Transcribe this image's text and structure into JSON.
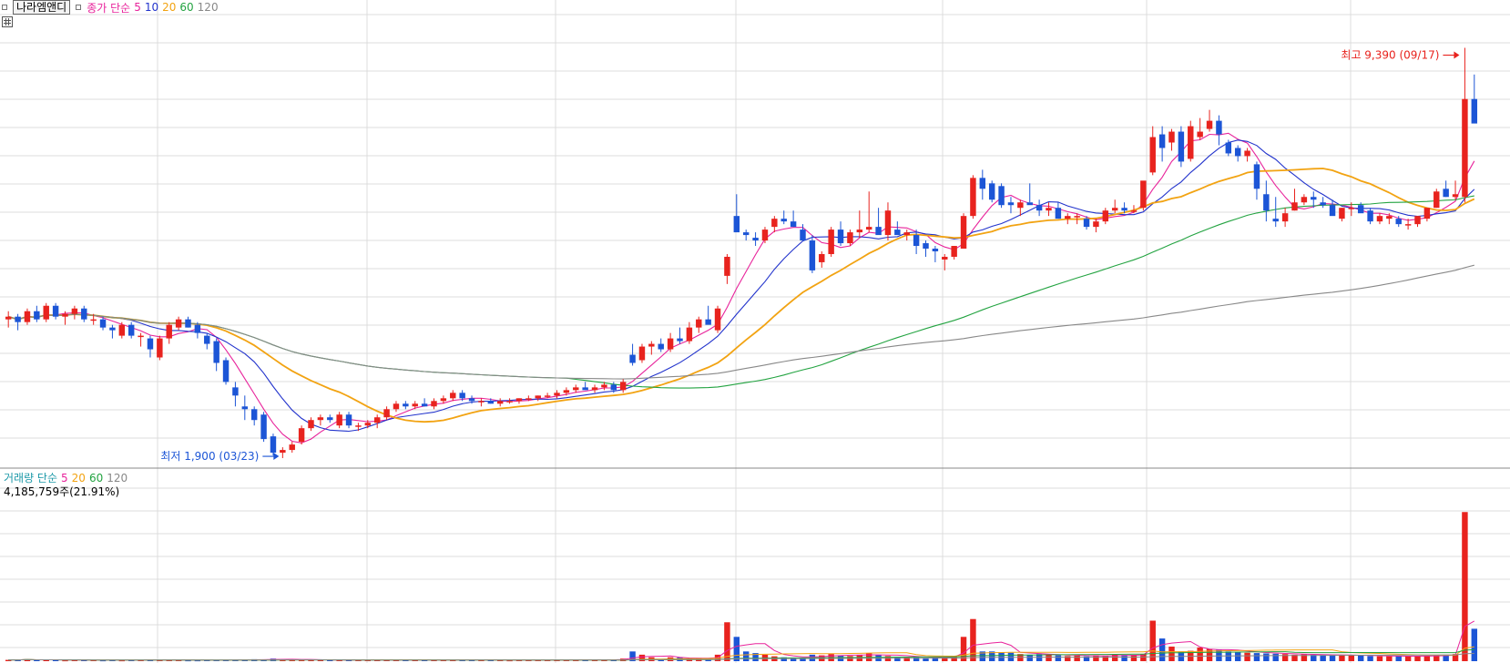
{
  "header": {
    "stock_name": "나라엠앤디",
    "price_legend": {
      "label": "종가 단순",
      "periods": [
        "5",
        "10",
        "20",
        "60",
        "120"
      ]
    },
    "volume_legend": {
      "label": "거래량 단순",
      "periods": [
        "5",
        "20",
        "60",
        "120"
      ]
    },
    "volume_value": "4,185,759주(21.91%)"
  },
  "annotations": {
    "high": "최고 9,390 (09/17)",
    "low": "최저 1,900 (03/23)"
  },
  "colors": {
    "up": "#e8231e",
    "down": "#1c55d6",
    "ma5": "#e8239b",
    "ma10": "#2233cc",
    "ma20": "#f2a312",
    "ma60": "#22a340",
    "ma120": "#888888",
    "grid": "#dcdcdc"
  },
  "chart_data": {
    "type": "candlestick",
    "y_range": [
      1700,
      9600
    ],
    "candles": [
      [
        4400,
        4550,
        4250,
        4450
      ],
      [
        4450,
        4500,
        4200,
        4350
      ],
      [
        4350,
        4600,
        4300,
        4550
      ],
      [
        4550,
        4650,
        4350,
        4400
      ],
      [
        4400,
        4700,
        4350,
        4650
      ],
      [
        4650,
        4700,
        4400,
        4450
      ],
      [
        4450,
        4550,
        4300,
        4500
      ],
      [
        4500,
        4650,
        4400,
        4600
      ],
      [
        4600,
        4650,
        4350,
        4400
      ],
      [
        4400,
        4500,
        4300,
        4400
      ],
      [
        4400,
        4450,
        4200,
        4250
      ],
      [
        4250,
        4300,
        4050,
        4200
      ],
      [
        4100,
        4350,
        4050,
        4300
      ],
      [
        4300,
        4350,
        4050,
        4100
      ],
      [
        4100,
        4150,
        3900,
        4100
      ],
      [
        4050,
        4100,
        3700,
        3850
      ],
      [
        3700,
        4100,
        3650,
        4050
      ],
      [
        4050,
        4350,
        3950,
        4300
      ],
      [
        4250,
        4450,
        4200,
        4400
      ],
      [
        4400,
        4450,
        4250,
        4250
      ],
      [
        4300,
        4350,
        4050,
        4150
      ],
      [
        4100,
        4150,
        3850,
        3950
      ],
      [
        4000,
        4050,
        3450,
        3600
      ],
      [
        3650,
        3700,
        3200,
        3250
      ],
      [
        3150,
        3250,
        2800,
        3000
      ],
      [
        2800,
        3000,
        2550,
        2750
      ],
      [
        2750,
        2800,
        2450,
        2550
      ],
      [
        2650,
        2700,
        2150,
        2200
      ],
      [
        2250,
        2300,
        1900,
        1950
      ],
      [
        1950,
        2050,
        1850,
        2000
      ],
      [
        2000,
        2150,
        1950,
        2100
      ],
      [
        2150,
        2450,
        2100,
        2400
      ],
      [
        2400,
        2600,
        2350,
        2550
      ],
      [
        2550,
        2650,
        2450,
        2600
      ],
      [
        2600,
        2650,
        2500,
        2550
      ],
      [
        2450,
        2700,
        2400,
        2650
      ],
      [
        2650,
        2700,
        2400,
        2450
      ],
      [
        2450,
        2500,
        2350,
        2450
      ],
      [
        2450,
        2550,
        2400,
        2500
      ],
      [
        2500,
        2650,
        2400,
        2600
      ],
      [
        2600,
        2800,
        2550,
        2750
      ],
      [
        2750,
        2900,
        2700,
        2850
      ],
      [
        2850,
        2900,
        2750,
        2800
      ],
      [
        2800,
        2900,
        2750,
        2850
      ],
      [
        2850,
        2950,
        2800,
        2800
      ],
      [
        2800,
        2950,
        2750,
        2900
      ],
      [
        2900,
        3000,
        2850,
        2950
      ],
      [
        2950,
        3100,
        2900,
        3050
      ],
      [
        3050,
        3100,
        2900,
        2950
      ],
      [
        2950,
        3000,
        2850,
        2900
      ],
      [
        2900,
        2950,
        2800,
        2900
      ],
      [
        2900,
        2950,
        2850,
        2850
      ],
      [
        2850,
        2950,
        2800,
        2900
      ],
      [
        2900,
        2950,
        2850,
        2900
      ],
      [
        2900,
        2950,
        2850,
        2950
      ],
      [
        2950,
        3000,
        2900,
        2950
      ],
      [
        2950,
        3000,
        2900,
        3000
      ],
      [
        3000,
        3050,
        2950,
        3000
      ],
      [
        3000,
        3100,
        2950,
        3050
      ],
      [
        3050,
        3150,
        3000,
        3100
      ],
      [
        3100,
        3200,
        3050,
        3150
      ],
      [
        3150,
        3250,
        3100,
        3100
      ],
      [
        3100,
        3200,
        3050,
        3150
      ],
      [
        3150,
        3250,
        3100,
        3200
      ],
      [
        3200,
        3250,
        3050,
        3100
      ],
      [
        3100,
        3300,
        3050,
        3250
      ],
      [
        3750,
        3950,
        3550,
        3600
      ],
      [
        3650,
        3950,
        3600,
        3900
      ],
      [
        3900,
        4000,
        3750,
        3950
      ],
      [
        3950,
        4050,
        3800,
        3850
      ],
      [
        3850,
        4150,
        3800,
        4050
      ],
      [
        4050,
        4250,
        3950,
        4000
      ],
      [
        4000,
        4350,
        3950,
        4250
      ],
      [
        4250,
        4450,
        4150,
        4400
      ],
      [
        4400,
        4650,
        4350,
        4300
      ],
      [
        4200,
        4650,
        4150,
        4600
      ],
      [
        5200,
        5600,
        5050,
        5550
      ],
      [
        6300,
        6700,
        6100,
        6000
      ],
      [
        6000,
        6050,
        5850,
        5950
      ],
      [
        5900,
        6000,
        5750,
        5850
      ],
      [
        5850,
        6100,
        5800,
        6050
      ],
      [
        6100,
        6300,
        6000,
        6250
      ],
      [
        6250,
        6400,
        6150,
        6200
      ],
      [
        6200,
        6400,
        6100,
        6100
      ],
      [
        6050,
        6150,
        5850,
        5850
      ],
      [
        5850,
        5950,
        5250,
        5300
      ],
      [
        5450,
        5650,
        5350,
        5600
      ],
      [
        5600,
        6100,
        5550,
        6050
      ],
      [
        6050,
        6200,
        5750,
        5800
      ],
      [
        5800,
        6050,
        5750,
        6000
      ],
      [
        6000,
        6400,
        5900,
        6050
      ],
      [
        6050,
        6750,
        6000,
        6100
      ],
      [
        6100,
        6450,
        6000,
        5950
      ],
      [
        5950,
        6550,
        5850,
        6400
      ],
      [
        6050,
        6200,
        5950,
        5950
      ],
      [
        5950,
        6050,
        5850,
        6000
      ],
      [
        5950,
        6050,
        5600,
        5750
      ],
      [
        5800,
        5850,
        5550,
        5700
      ],
      [
        5700,
        5750,
        5450,
        5650
      ],
      [
        5500,
        5600,
        5300,
        5550
      ],
      [
        5550,
        5750,
        5500,
        5750
      ],
      [
        5700,
        6350,
        5700,
        6300
      ],
      [
        6300,
        7050,
        6250,
        7000
      ],
      [
        7000,
        7150,
        6600,
        6800
      ],
      [
        6900,
        6950,
        6550,
        6600
      ],
      [
        6850,
        6900,
        6450,
        6500
      ],
      [
        6550,
        6650,
        6350,
        6500
      ],
      [
        6450,
        6600,
        6300,
        6550
      ],
      [
        6550,
        6900,
        6550,
        6500
      ],
      [
        6500,
        6600,
        6300,
        6400
      ],
      [
        6400,
        6550,
        6300,
        6450
      ],
      [
        6450,
        6550,
        6250,
        6250
      ],
      [
        6250,
        6350,
        6150,
        6300
      ],
      [
        6300,
        6350,
        6150,
        6300
      ],
      [
        6250,
        6300,
        6050,
        6100
      ],
      [
        6100,
        6250,
        6000,
        6200
      ],
      [
        6200,
        6450,
        6150,
        6400
      ],
      [
        6400,
        6600,
        6350,
        6450
      ],
      [
        6450,
        6550,
        6350,
        6400
      ],
      [
        6400,
        6500,
        6350,
        6400
      ],
      [
        6450,
        6900,
        6400,
        6950
      ],
      [
        7100,
        7950,
        7050,
        7750
      ],
      [
        7800,
        7950,
        7300,
        7550
      ],
      [
        7650,
        7900,
        7500,
        7850
      ],
      [
        7850,
        7950,
        7200,
        7300
      ],
      [
        7350,
        8050,
        7300,
        7950
      ],
      [
        7750,
        8100,
        7700,
        7850
      ],
      [
        7900,
        8250,
        7850,
        8050
      ],
      [
        8050,
        8150,
        7600,
        7800
      ],
      [
        7650,
        7700,
        7400,
        7450
      ],
      [
        7550,
        7600,
        7300,
        7400
      ],
      [
        7400,
        7550,
        7300,
        7500
      ],
      [
        7250,
        7300,
        6600,
        6800
      ],
      [
        6700,
        6950,
        6200,
        6400
      ],
      [
        6250,
        6650,
        6100,
        6200
      ],
      [
        6200,
        6450,
        6100,
        6350
      ],
      [
        6400,
        6800,
        6400,
        6550
      ],
      [
        6550,
        6700,
        6500,
        6650
      ],
      [
        6650,
        6750,
        6450,
        6600
      ],
      [
        6550,
        6650,
        6450,
        6500
      ],
      [
        6500,
        6600,
        6350,
        6300
      ],
      [
        6250,
        6450,
        6200,
        6450
      ],
      [
        6450,
        6550,
        6300,
        6450
      ],
      [
        6500,
        6550,
        6400,
        6350
      ],
      [
        6400,
        6450,
        6150,
        6200
      ],
      [
        6200,
        6350,
        6150,
        6300
      ],
      [
        6250,
        6350,
        6150,
        6300
      ],
      [
        6250,
        6300,
        6100,
        6150
      ],
      [
        6150,
        6250,
        6050,
        6150
      ],
      [
        6150,
        6300,
        6100,
        6300
      ],
      [
        6250,
        6450,
        6200,
        6450
      ],
      [
        6450,
        6800,
        6450,
        6750
      ],
      [
        6800,
        6950,
        6650,
        6650
      ],
      [
        6650,
        6950,
        6600,
        6700
      ],
      [
        6650,
        9390,
        6550,
        8450
      ],
      [
        8450,
        8900,
        8100,
        8000
      ]
    ],
    "volume_range": [
      0,
      5000000
    ],
    "volumes": [
      40000,
      40000,
      60000,
      30000,
      45000,
      40000,
      25000,
      30000,
      35000,
      30000,
      25000,
      30000,
      25000,
      35000,
      30000,
      45000,
      40000,
      35000,
      30000,
      25000,
      25000,
      35000,
      30000,
      35000,
      40000,
      45000,
      60000,
      45000,
      80000,
      55000,
      50000,
      40000,
      35000,
      40000,
      30000,
      35000,
      30000,
      30000,
      40000,
      35000,
      35000,
      30000,
      40000,
      35000,
      30000,
      40000,
      30000,
      35000,
      30000,
      40000,
      30000,
      35000,
      30000,
      25000,
      30000,
      35000,
      40000,
      30000,
      35000,
      40000,
      45000,
      50000,
      35000,
      40000,
      35000,
      80000,
      300000,
      200000,
      120000,
      60000,
      120000,
      110000,
      80000,
      100000,
      60000,
      200000,
      1200000,
      750000,
      300000,
      250000,
      200000,
      150000,
      120000,
      110000,
      90000,
      200000,
      180000,
      220000,
      170000,
      160000,
      200000,
      240000,
      200000,
      160000,
      120000,
      140000,
      120000,
      100000,
      120000,
      130000,
      160000,
      750000,
      1300000,
      300000,
      300000,
      280000,
      260000,
      220000,
      200000,
      220000,
      190000,
      180000,
      160000,
      170000,
      150000,
      180000,
      160000,
      200000,
      190000,
      180000,
      220000,
      1250000,
      700000,
      450000,
      300000,
      320000,
      420000,
      380000,
      350000,
      300000,
      280000,
      260000,
      250000,
      240000,
      230000,
      220000,
      200000,
      210000,
      200000,
      190000,
      190000,
      180000,
      180000,
      170000,
      160000,
      150000,
      150000,
      160000,
      150000,
      160000,
      170000,
      180000,
      200000,
      220000,
      4600000,
      1000000
    ],
    "moving_averages": {
      "price": [
        "5",
        "10",
        "20",
        "60",
        "120"
      ],
      "volume": [
        "5",
        "20",
        "60",
        "120"
      ]
    }
  }
}
